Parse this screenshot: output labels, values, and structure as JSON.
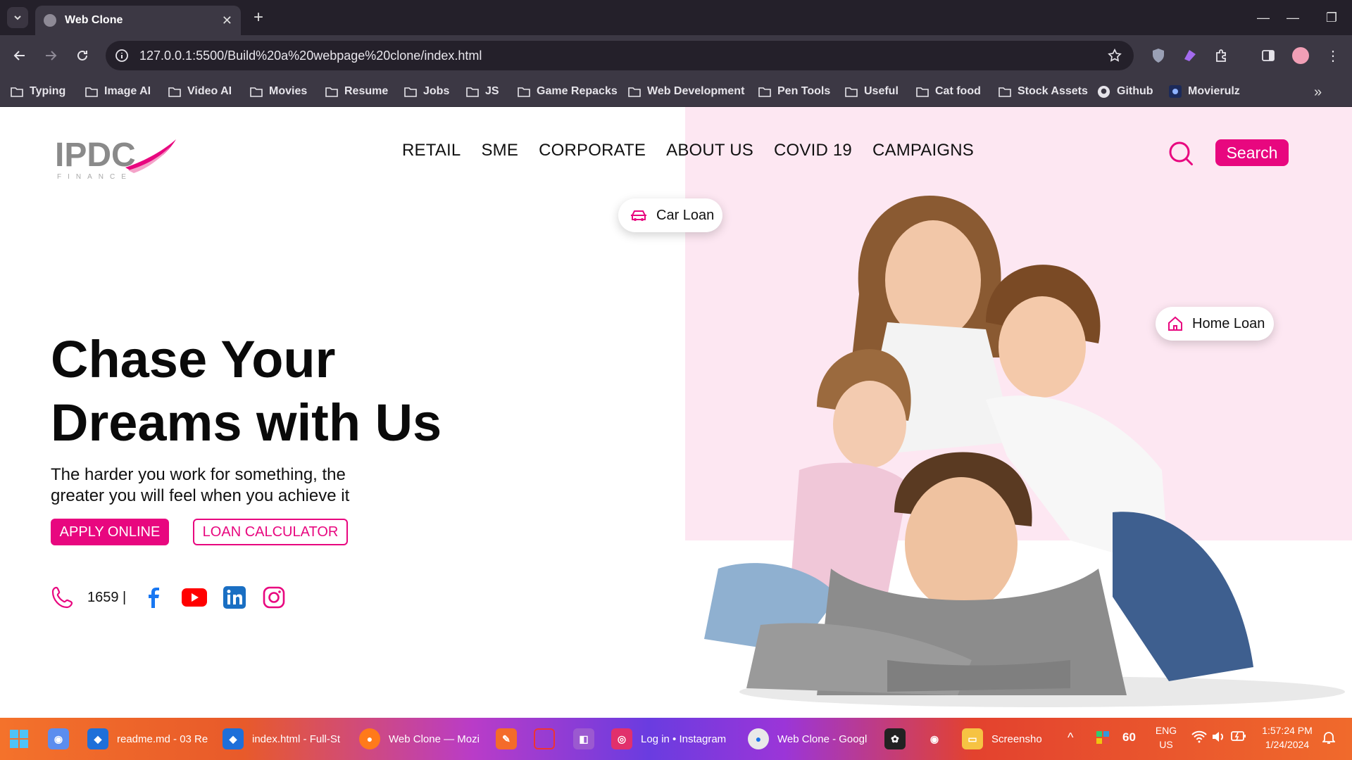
{
  "browser": {
    "tab_title": "Web Clone",
    "url": "127.0.0.1:5500/Build%20a%20webpage%20clone/index.html",
    "bookmarks": [
      "Typing",
      "Image AI",
      "Video AI",
      "Movies",
      "Resume",
      "Jobs",
      "JS",
      "Game Repacks",
      "Web Development",
      "Pen Tools",
      "Useful",
      "Cat food",
      "Stock Assets",
      "Github",
      "Movierulz"
    ]
  },
  "site": {
    "logo_text": "IPDC",
    "logo_sub": "FINANCE",
    "nav": [
      "RETAIL",
      "SME",
      "CORPORATE",
      "ABOUT US",
      "COVID 19",
      "CAMPAIGNS"
    ],
    "search_label": "Search",
    "car_loan": "Car Loan",
    "home_loan": "Home Loan",
    "headline_line1": "Chase Your",
    "headline_line2": "Dreams with Us",
    "subline_line1": "The harder you work for something, the",
    "subline_line2": "greater you will feel when you achieve it",
    "apply_label": "APPLY ONLINE",
    "calc_label": "LOAN CALCULATOR",
    "phone": "1659 |",
    "social_icons": [
      "facebook-icon",
      "youtube-icon",
      "linkedin-icon",
      "instagram-icon"
    ],
    "brand_color": "#e8077f",
    "hero_bg": "#fde7f2"
  },
  "taskbar": {
    "items": [
      "readme.md - 03 Re",
      "index.html - Full-St",
      "Web Clone — Mozi",
      "Log in • Instagram",
      "Web Clone - Googl",
      "Screensho"
    ],
    "battery": "60",
    "lang_line1": "ENG",
    "lang_line2": "US",
    "time": "1:57:24 PM",
    "date": "1/24/2024"
  }
}
